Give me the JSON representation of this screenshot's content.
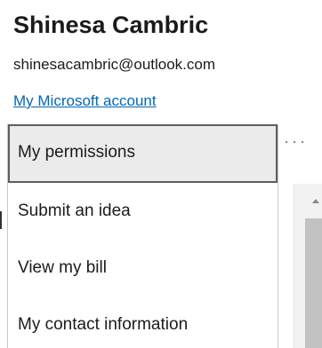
{
  "account": {
    "name": "Shinesa Cambric",
    "email": "shinesacambric@outlook.com",
    "account_link": "My Microsoft account"
  },
  "overflow_menu": {
    "more_label": "···",
    "items": [
      {
        "label": "My permissions",
        "selected": true
      },
      {
        "label": "Submit an idea",
        "selected": false
      },
      {
        "label": "View my bill",
        "selected": false
      },
      {
        "label": "My contact information",
        "selected": false
      }
    ]
  },
  "icons": {
    "more": "more-horizontal-icon",
    "scroll_up": "chevron-up-icon"
  },
  "colors": {
    "link": "#0067b8",
    "selected_bg": "#ebebeb",
    "selected_border": "#5e5e5e"
  }
}
